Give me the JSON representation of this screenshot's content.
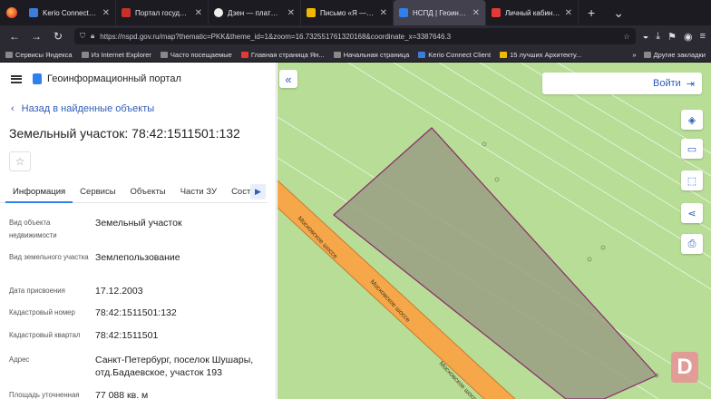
{
  "browser": {
    "tabs": [
      {
        "title": "Kerio Connect Client",
        "color": "#3b7dd8"
      },
      {
        "title": "Портал государстве",
        "color": "#c9302c"
      },
      {
        "title": "Дзен — платформа д",
        "color": "#222222"
      },
      {
        "title": "Письмо «Я — про",
        "color": "#f2b705"
      },
      {
        "title": "НСПД | Геоинформа",
        "color": "#2f80ed",
        "active": true
      },
      {
        "title": "Личный кабинет «Е",
        "color": "#e53935"
      }
    ],
    "url": "https://nspd.gov.ru/map?thematic=PKK&theme_id=1&zoom=16.732551761320168&coordinate_x=3387646.3",
    "bookmarks": [
      "Сервисы Яндекса",
      "Из Internet Explorer",
      "Часто посещаемые",
      "Главная страница Ян...",
      "Начальная страница",
      "Kerio Connect Client",
      "15 лучших Архитекту..."
    ],
    "bookmarks_right": "Другие закладки"
  },
  "panel": {
    "portal_name": "Геоинформационный портал",
    "back_label": "Назад в найденные объекты",
    "title": "Земельный участок: 78:42:1511501:132",
    "tabs": [
      "Информация",
      "Сервисы",
      "Объекты",
      "Части ЗУ",
      "Соста"
    ],
    "rows": [
      {
        "key": "Вид объекта недвижимости",
        "value": "Земельный участок"
      },
      {
        "key": "Вид земельного участка",
        "value": "Землепользование"
      },
      {
        "key": "Дата присвоения",
        "value": "17.12.2003"
      },
      {
        "key": "Кадастровый номер",
        "value": "78:42:1511501:132"
      },
      {
        "key": "Кадастровый квартал",
        "value": "78:42:1511501"
      },
      {
        "key": "Адрес",
        "value": "Санкт-Петербург, поселок Шушары, отд.Бадаевское, участок 193"
      },
      {
        "key": "Площадь уточненная",
        "value": "77 088 кв. м"
      }
    ]
  },
  "map": {
    "login_label": "Войти",
    "road_label": "Московское шоссе",
    "colors": {
      "field": "#b7dd97",
      "road": "#f5a74a",
      "parcel_fill": "#9a9f82",
      "parcel_border": "#8a2a6a"
    }
  }
}
